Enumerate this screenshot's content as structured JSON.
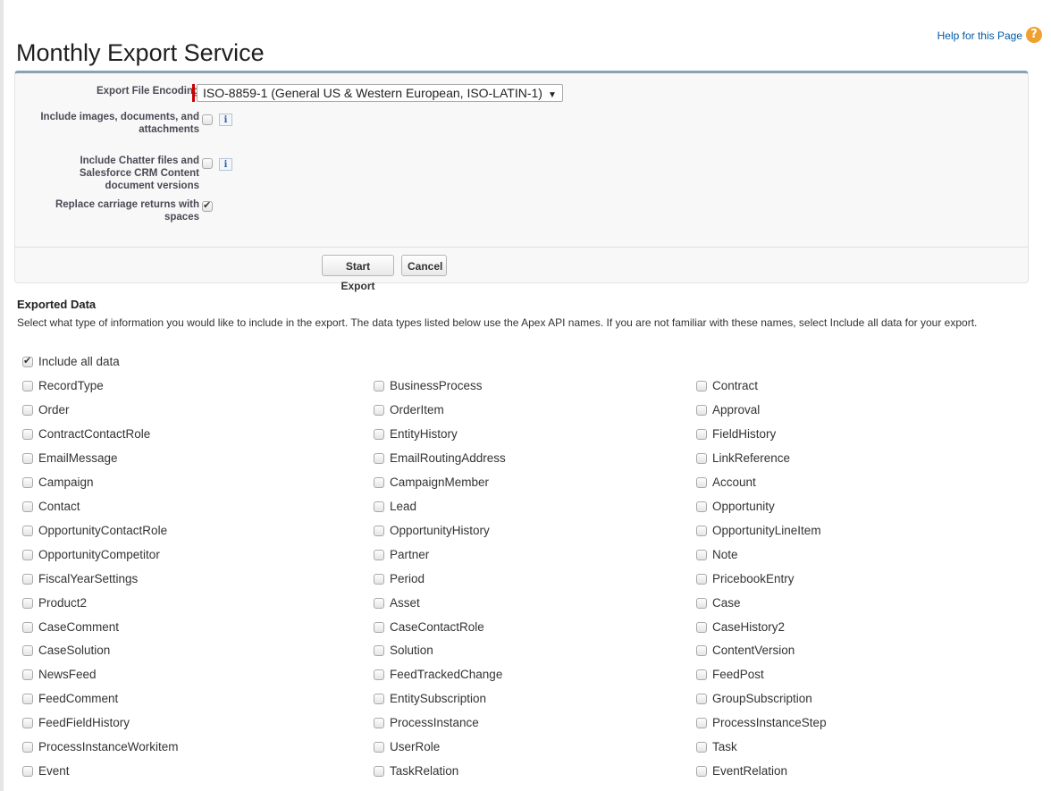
{
  "page": {
    "title": "Monthly Export Service",
    "help_link": "Help for this Page",
    "help_icon_glyph": "?"
  },
  "form": {
    "encoding_label": "Export File Encoding",
    "encoding_value": "ISO-8859-1 (General US & Western European, ISO-LATIN-1)",
    "include_images_label": "Include images, documents, and attachments",
    "include_images_checked": false,
    "include_chatter_label": "Include Chatter files and Salesforce CRM Content document versions",
    "include_chatter_checked": false,
    "replace_cr_label": "Replace carriage returns with spaces",
    "replace_cr_checked": true,
    "info_glyph": "i"
  },
  "buttons": {
    "start_export": "Start Export",
    "cancel": "Cancel"
  },
  "exported": {
    "title": "Exported Data",
    "description": "Select what type of information you would like to include in the export. The data types listed below use the Apex API names. If you are not familiar with these names, select Include all data for your export.",
    "include_all_label": "Include all data",
    "include_all_checked": true,
    "columns": [
      [
        "RecordType",
        "Order",
        "ContractContactRole",
        "EmailMessage",
        "Campaign",
        "Contact",
        "OpportunityContactRole",
        "OpportunityCompetitor",
        "FiscalYearSettings",
        "Product2",
        "CaseComment",
        "CaseSolution",
        "NewsFeed",
        "FeedComment",
        "FeedFieldHistory",
        "ProcessInstanceWorkitem",
        "Event"
      ],
      [
        "BusinessProcess",
        "OrderItem",
        "EntityHistory",
        "EmailRoutingAddress",
        "CampaignMember",
        "Lead",
        "OpportunityHistory",
        "Partner",
        "Period",
        "Asset",
        "CaseContactRole",
        "Solution",
        "FeedTrackedChange",
        "EntitySubscription",
        "ProcessInstance",
        "UserRole",
        "TaskRelation"
      ],
      [
        "Contract",
        "Approval",
        "FieldHistory",
        "LinkReference",
        "Account",
        "Opportunity",
        "OpportunityLineItem",
        "Note",
        "PricebookEntry",
        "Case",
        "CaseHistory2",
        "ContentVersion",
        "FeedPost",
        "GroupSubscription",
        "ProcessInstanceStep",
        "Task",
        "EventRelation"
      ]
    ]
  },
  "colors": {
    "panel_border": "#8aa1b4",
    "required_marker": "#cc0000",
    "link": "#015ba7",
    "help_icon": "#f0a02e"
  }
}
